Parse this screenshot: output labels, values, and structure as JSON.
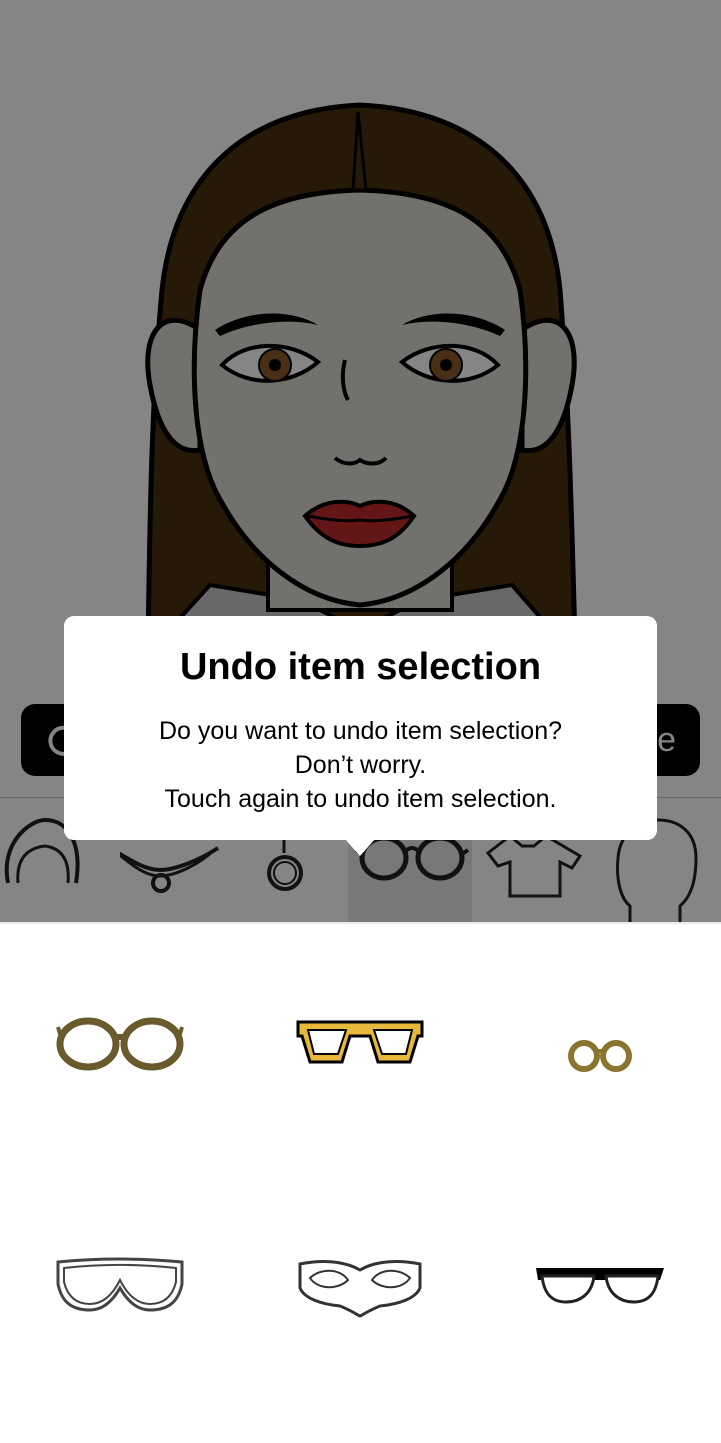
{
  "dialog": {
    "title": "Undo item selection",
    "line1": "Do you want to undo item selection?",
    "line2": "Don’t worry.",
    "line3": "Touch again to undo item selection."
  },
  "toolbar": {
    "undo_icon": "undo-icon",
    "save_label_visible": "e"
  },
  "categories": [
    {
      "name": "hair",
      "icon": "hair-icon"
    },
    {
      "name": "necklace",
      "icon": "necklace-icon"
    },
    {
      "name": "earring",
      "icon": "earring-icon"
    },
    {
      "name": "glasses",
      "icon": "glasses-icon",
      "selected": true
    },
    {
      "name": "shirt",
      "icon": "shirt-icon"
    },
    {
      "name": "head",
      "icon": "head-silhouette-icon"
    }
  ],
  "items": [
    {
      "name": "round-glasses",
      "color": "#6b5a2e"
    },
    {
      "name": "square-glasses",
      "color": "#e8b83a"
    },
    {
      "name": "small-round-glasses",
      "color": "#8a7530"
    },
    {
      "name": "goggles",
      "color": "#ffffff"
    },
    {
      "name": "mask",
      "color": "#ffffff"
    },
    {
      "name": "browline-glasses",
      "color": "#000000"
    }
  ],
  "colors": {
    "hair": "#4a3010",
    "skin": "#ddd8d2",
    "lips": "#c0292a",
    "iris": "#8a5a2a",
    "overlay": "rgba(0,0,0,0.48)"
  }
}
